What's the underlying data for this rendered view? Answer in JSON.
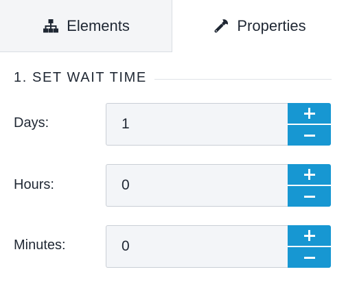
{
  "tabs": {
    "elements": {
      "label": "Elements",
      "icon": "sitemap-icon"
    },
    "properties": {
      "label": "Properties",
      "icon": "wrench-icon",
      "active": true
    }
  },
  "section": {
    "heading": "1. SET WAIT TIME"
  },
  "fields": {
    "days": {
      "label": "Days:",
      "value": "1"
    },
    "hours": {
      "label": "Hours:",
      "value": "0"
    },
    "minutes": {
      "label": "Minutes:",
      "value": "0"
    }
  },
  "colors": {
    "accent": "#1797d2",
    "inactive_tab_bg": "#f4f5f7",
    "field_bg": "#f3f5f8",
    "text": "#1f2733"
  }
}
